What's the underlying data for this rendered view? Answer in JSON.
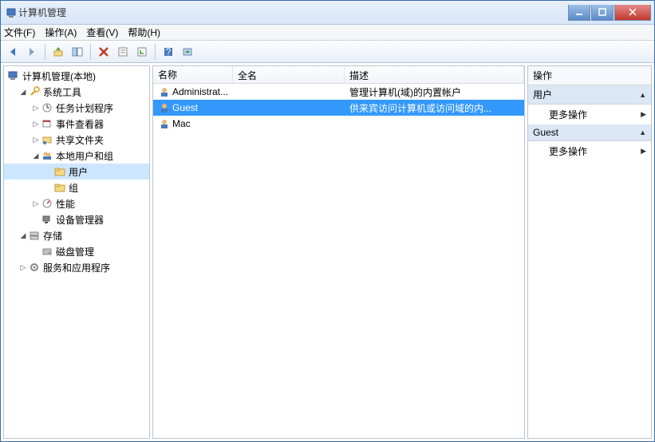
{
  "window": {
    "title": "计算机管理"
  },
  "menu": {
    "file": "文件(F)",
    "action": "操作(A)",
    "view": "查看(V)",
    "help": "帮助(H)"
  },
  "tree": {
    "root": "计算机管理(本地)",
    "system_tools": "系统工具",
    "task_scheduler": "任务计划程序",
    "event_viewer": "事件查看器",
    "shared_folders": "共享文件夹",
    "local_users_groups": "本地用户和组",
    "users": "用户",
    "groups": "组",
    "performance": "性能",
    "device_manager": "设备管理器",
    "storage": "存储",
    "disk_management": "磁盘管理",
    "services_apps": "服务和应用程序"
  },
  "list": {
    "col_name": "名称",
    "col_fullname": "全名",
    "col_desc": "描述",
    "rows": [
      {
        "name": "Administrat...",
        "fullname": "",
        "desc": "管理计算机(域)的内置帐户"
      },
      {
        "name": "Guest",
        "fullname": "",
        "desc": "供来宾访问计算机或访问域的内..."
      },
      {
        "name": "Mac",
        "fullname": "",
        "desc": ""
      }
    ]
  },
  "actions": {
    "header": "操作",
    "group1": "用户",
    "more1": "更多操作",
    "group2": "Guest",
    "more2": "更多操作"
  }
}
